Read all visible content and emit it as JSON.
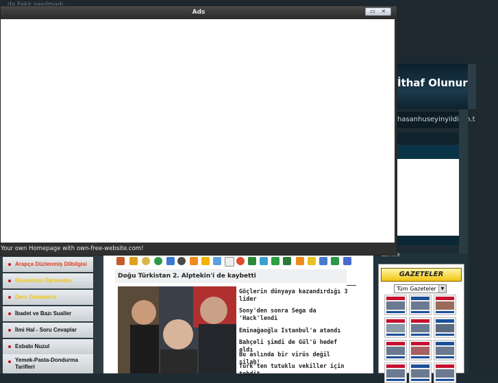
{
  "background": {
    "top_text": "…da Fakir sayılmadı…",
    "header_title": "İthaf Olunur",
    "site_url": "hasanhuseyinyildirim.t",
    "site_badge": "Lsmtle"
  },
  "popup": {
    "title": "Ads",
    "footer_text": "Your own Homepage with own-free-website.com!"
  },
  "left_nav": {
    "items": [
      {
        "label": "Arapça Düzlenmiş Dilbilgisi",
        "color": "#e23a1a"
      },
      {
        "label": "Osmanlıca Öğrenelim",
        "color": "#f2c40f"
      },
      {
        "label": "Ders Osmanlıca",
        "color": "#f2c40f"
      },
      {
        "label": "İbadet ve Bazı Sualler",
        "color": "#111111"
      },
      {
        "label": "İlmi Hal - Soru Cevaplar",
        "color": "#111111"
      },
      {
        "label": "Esbabı Nuzul",
        "color": "#111111"
      },
      {
        "label": "Yemek-Pasta-Dondurma Tarifleri",
        "color": "#111111"
      }
    ]
  },
  "main": {
    "headline": "Doğu Türkistan 2. Alptekin'i de kaybetti",
    "news": [
      "Göçlerin dünyaya kazandırdığı 3 lider",
      "Sony'den sonra Sega da 'Hack'lendi",
      "Eminağaoğlu Istanbul'a atandı",
      "Bahçeli şimdi de Gül'ü hedef aldı",
      "Bu aslında bir virüs değil silah!",
      "Türk'ten tutuklu vekiller için tehdit"
    ],
    "share_icons": [
      "delicious-icon",
      "digg-icon",
      "furl-icon",
      "stumble-icon",
      "a-icon",
      "globe-icon",
      "orange-icon",
      "yahoo-icon",
      "s-icon",
      "google-icon",
      "windows-icon",
      "arrow-icon",
      "h-icon",
      "c-icon",
      "book-icon",
      "b-icon",
      "smile-icon",
      "monitor-icon",
      "n-icon",
      "help-icon"
    ]
  },
  "gazeteler": {
    "title": "GAZETELER",
    "select_value": "Tüm Gazeteler"
  }
}
